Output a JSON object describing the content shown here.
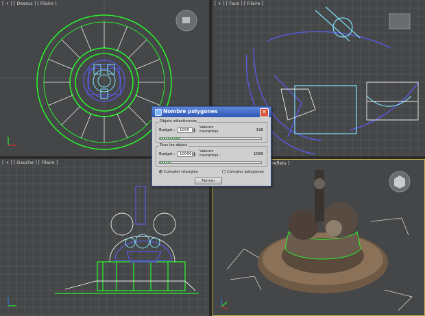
{
  "viewports": {
    "top": {
      "label": "[ + ] [ Dessus ] [ Filaire ]"
    },
    "front": {
      "label": "[ + ] [ Face ] [ Filaire ]"
    },
    "left": {
      "label": "[ + ] [ Gauche ] [ Filaire ]"
    },
    "perspective": {
      "label": "reflets ]"
    }
  },
  "dialog": {
    "title": "Nombre polygones",
    "close_glyph": "✕",
    "selected_group": {
      "title": "Objets sélectionnés",
      "budget_label": "Budget :",
      "budget_value": "1000",
      "current_label_line1": "Valeurs",
      "current_label_line2": "courantes",
      "current_value": "198",
      "progress_fraction": 0.2
    },
    "all_group": {
      "title": "Tous les objets",
      "budget_label": "Budget :",
      "budget_value": "10000",
      "current_label_line1": "Valeurs",
      "current_label_line2": "courantes :",
      "current_value": "1086",
      "progress_fraction": 0.11
    },
    "radio_triangles": "Compter triangles",
    "radio_polygons": "Compter polygones",
    "radio_selected": "triangles",
    "close_button": "Fermer"
  },
  "colors": {
    "viewport_bg": "#444648",
    "grid": "#5d5f61",
    "wire_green": "#2cf02c",
    "wire_white": "#f0f0f0",
    "wire_blue": "#5a5ae6",
    "wire_cyan": "#7fe6ff",
    "active_border": "#c8b44a"
  }
}
